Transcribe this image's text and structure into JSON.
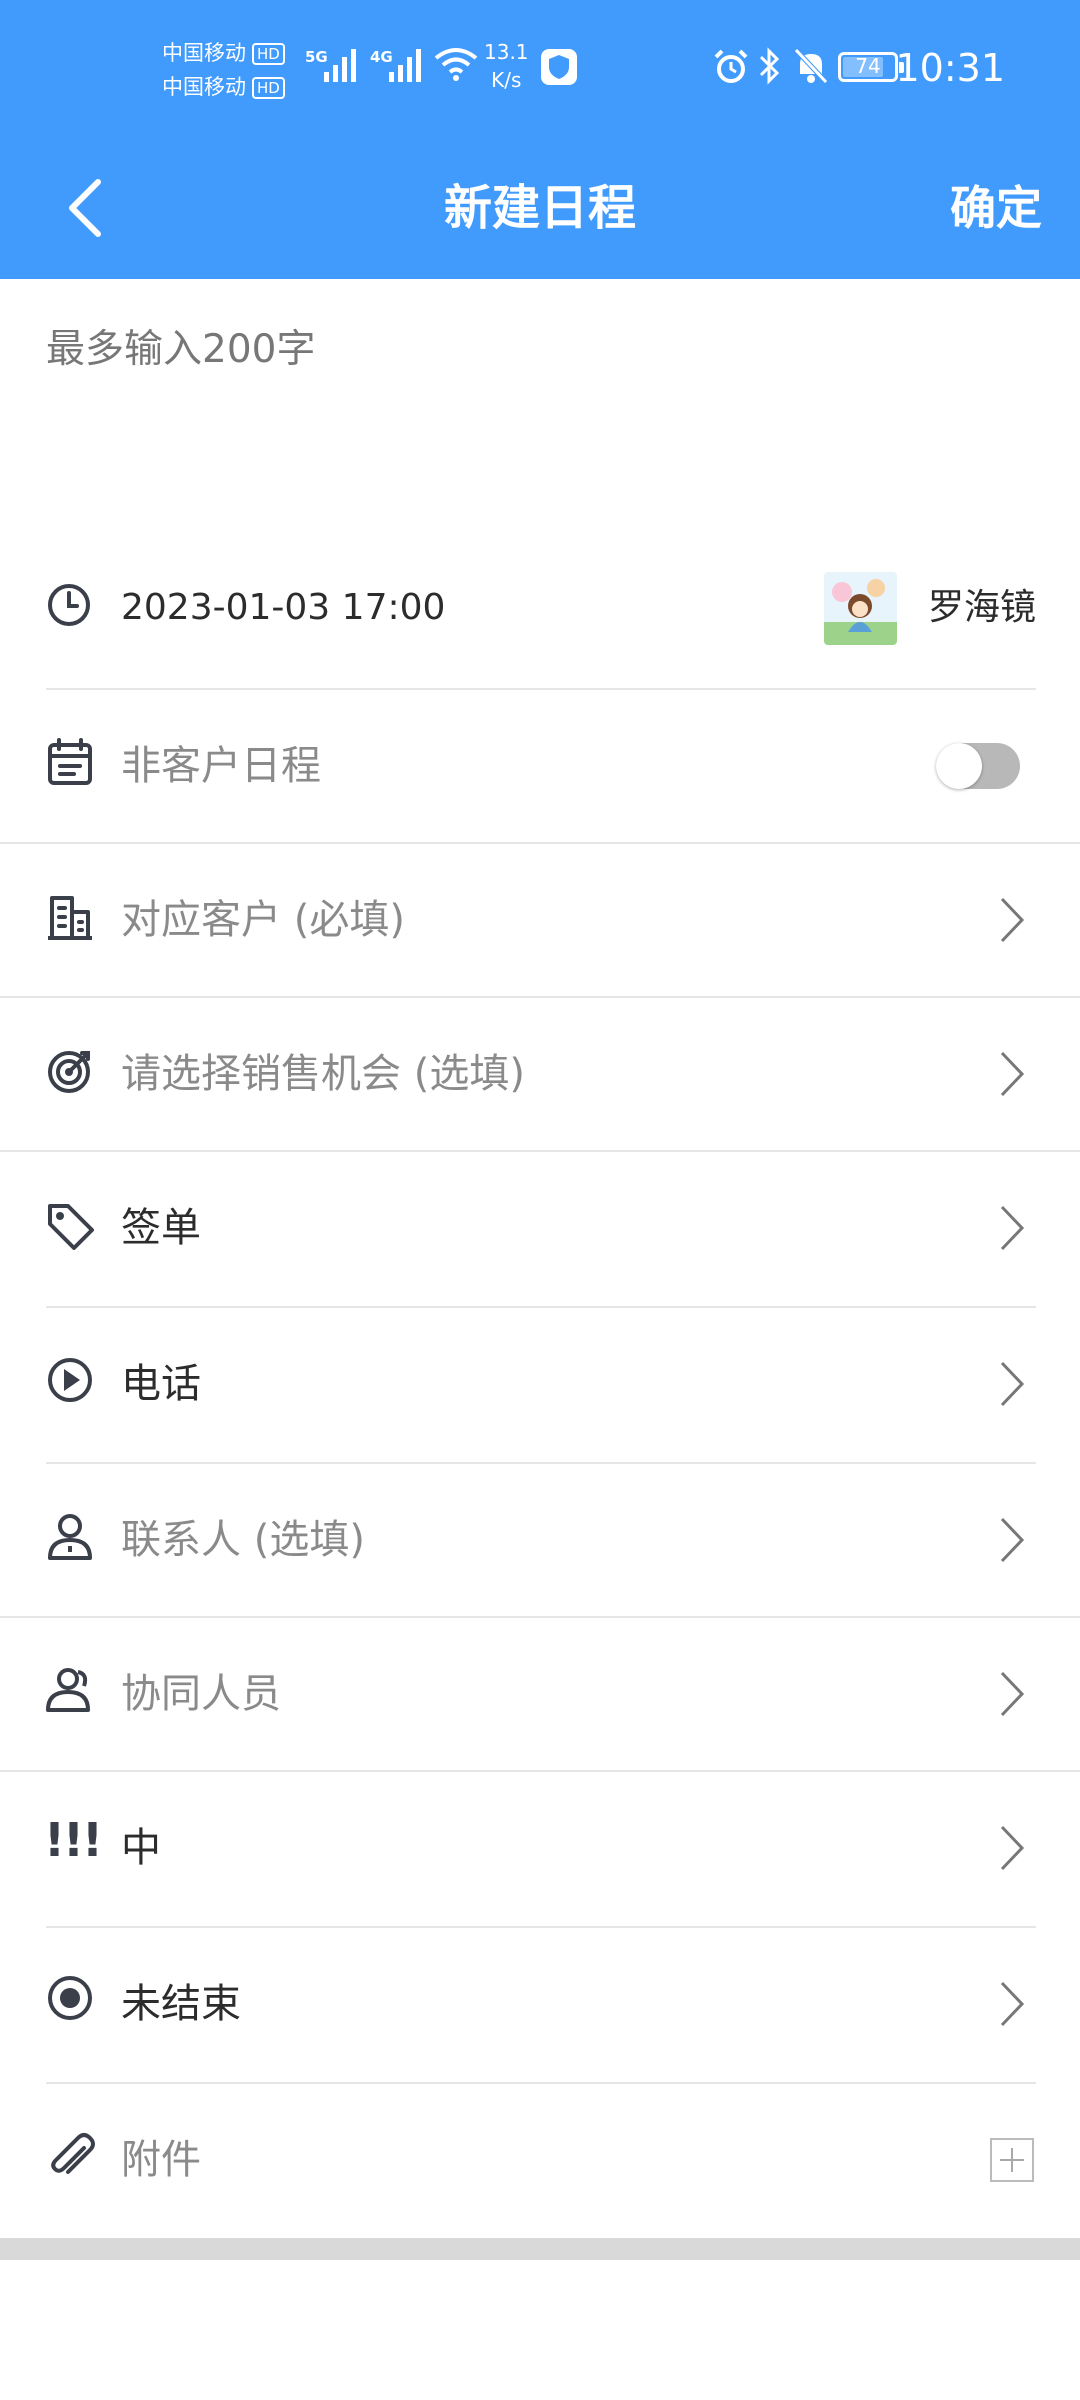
{
  "status_bar": {
    "carrier_1": "中国移动",
    "carrier_2": "中国移动",
    "hd_badge": "HD",
    "net_5g": "5G",
    "net_4g": "4G",
    "speed_value": "13.1",
    "speed_unit": "K/s",
    "battery": "74",
    "time": "10:31"
  },
  "header": {
    "title": "新建日程",
    "confirm_label": "确定",
    "back_icon": "chevron-left-icon",
    "bg_color": "#419bfd"
  },
  "note": {
    "placeholder": "最多输入200字"
  },
  "schedule": {
    "datetime": "2023-01-03 17:00",
    "owner": "罗海镜"
  },
  "rows": {
    "non_customer": {
      "label": "非客户日程",
      "toggle_on": false
    },
    "customer": {
      "label": "对应客户 (必填)"
    },
    "opportunity": {
      "label": "请选择销售机会 (选填)"
    },
    "type": {
      "label": "签单"
    },
    "method": {
      "label": "电话"
    },
    "contact": {
      "label": "联系人 (选填)"
    },
    "collaborators": {
      "label": "协同人员"
    },
    "priority": {
      "label": "中",
      "icon_text": "!!!"
    },
    "status": {
      "label": "未结束"
    },
    "attachment": {
      "label": "附件"
    }
  }
}
